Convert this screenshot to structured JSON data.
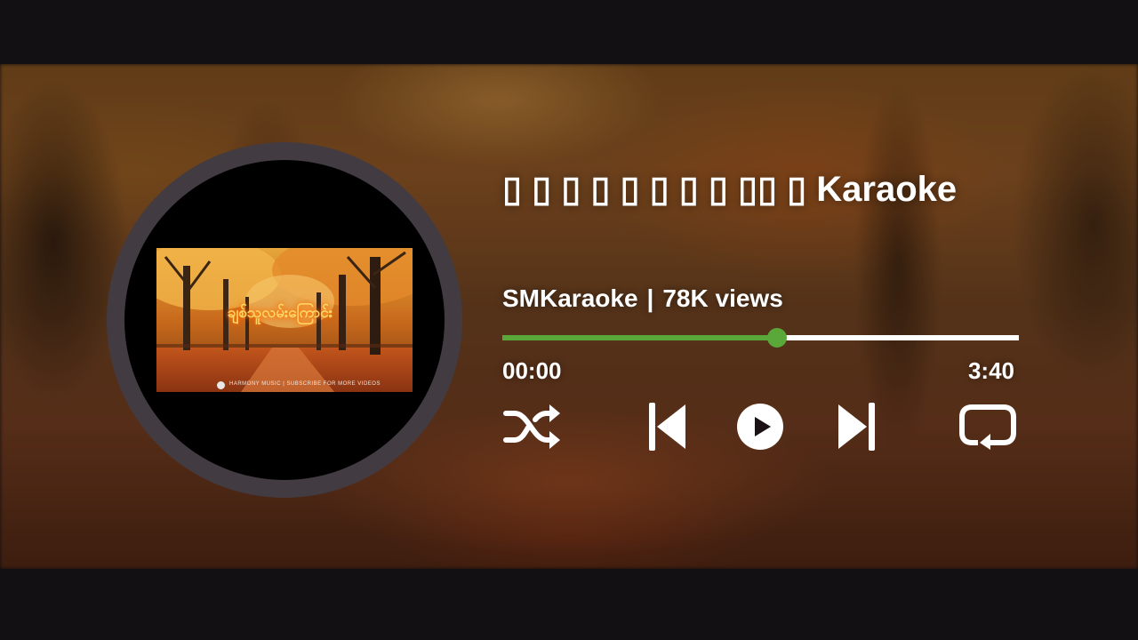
{
  "track": {
    "title": "▯ ▯ ▯ ▯ ▯ ▯ ▯ ▯ ▯▯ ▯ Karaoke",
    "channel": "SMKaraoke",
    "separator": "|",
    "views": "78K views"
  },
  "thumbnail": {
    "overlay_title": "ချစ်သူလမ်းကြောင်း",
    "credit": "HARMONY MUSIC | SUBSCRIBE FOR MORE VIDEOS"
  },
  "player": {
    "current_time": "00:00",
    "total_time": "3:40",
    "progress": 0.532
  },
  "controls": {
    "shuffle": "shuffle-icon",
    "previous": "skip-previous-icon",
    "play": "play-icon",
    "next": "skip-next-icon",
    "repeat": "repeat-icon"
  },
  "colors": {
    "accent": "#5aa83a",
    "track": "#ffffff",
    "disc_ring": "#433b42",
    "background": "#121013"
  }
}
